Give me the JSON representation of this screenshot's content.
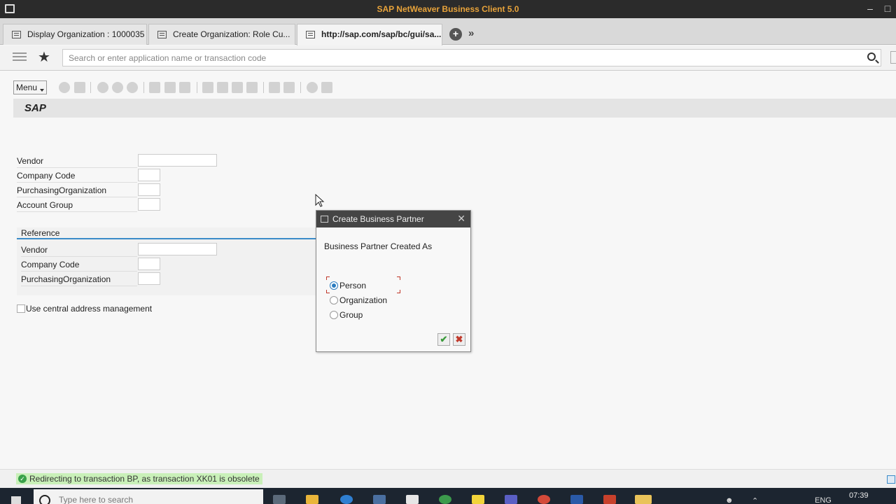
{
  "window": {
    "title": "SAP NetWeaver Business Client 5.0"
  },
  "tabs": [
    {
      "label": "Display Organization : 1000035"
    },
    {
      "label": "Create Organization: Role Cu..."
    },
    {
      "label": "http://sap.com/sap/bc/gui/sa..."
    }
  ],
  "search": {
    "placeholder": "Search or enter application name or transaction code"
  },
  "toolbar": {
    "menu_label": "Menu"
  },
  "banner": {
    "logo": "SAP"
  },
  "form": {
    "fields": [
      {
        "label": "Vendor",
        "value": ""
      },
      {
        "label": "Company Code",
        "value": ""
      },
      {
        "label": "PurchasingOrganization",
        "value": ""
      },
      {
        "label": "Account Group",
        "value": ""
      }
    ],
    "reference": {
      "title": "Reference",
      "fields": [
        {
          "label": "Vendor",
          "value": ""
        },
        {
          "label": "Company Code",
          "value": ""
        },
        {
          "label": "PurchasingOrganization",
          "value": ""
        }
      ]
    },
    "checkbox_label": "Use central address management"
  },
  "dialog": {
    "title": "Create Business Partner",
    "prompt": "Business Partner Created As",
    "options": [
      {
        "label": "Person",
        "selected": true
      },
      {
        "label": "Organization",
        "selected": false
      },
      {
        "label": "Group",
        "selected": false
      }
    ]
  },
  "status": {
    "message": "Redirecting to transaction BP, as transaction XK01 is obsolete"
  },
  "taskbar": {
    "search_placeholder": "Type here to search",
    "language": "ENG",
    "time": "07:39"
  },
  "colors": {
    "status_success": "#c9f0b9",
    "accent": "#3b8bc8",
    "title_text": "#e8a33a"
  }
}
